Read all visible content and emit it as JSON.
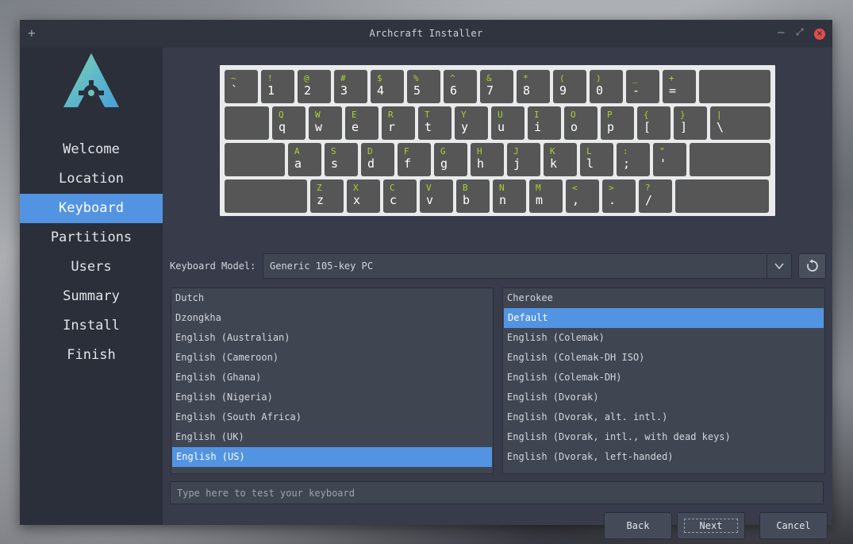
{
  "window": {
    "title": "Archcraft Installer",
    "pin_icon": "+",
    "minimize_icon": "–",
    "maximize_icon": "⤢",
    "close_icon": "×"
  },
  "sidebar": {
    "items": [
      {
        "label": "Welcome",
        "active": false
      },
      {
        "label": "Location",
        "active": false
      },
      {
        "label": "Keyboard",
        "active": true
      },
      {
        "label": "Partitions",
        "active": false
      },
      {
        "label": "Users",
        "active": false
      },
      {
        "label": "Summary",
        "active": false
      },
      {
        "label": "Install",
        "active": false
      },
      {
        "label": "Finish",
        "active": false
      }
    ]
  },
  "keyboard_preview": {
    "rows": [
      [
        [
          "~",
          "`"
        ],
        [
          "!",
          "1"
        ],
        [
          "@",
          "2"
        ],
        [
          "#",
          "3"
        ],
        [
          "$",
          "4"
        ],
        [
          "%",
          "5"
        ],
        [
          "^",
          "6"
        ],
        [
          "&",
          "7"
        ],
        [
          "*",
          "8"
        ],
        [
          "(",
          "9"
        ],
        [
          ")",
          "0"
        ],
        [
          "_",
          "-"
        ],
        [
          "+",
          "="
        ],
        [
          "",
          ""
        ]
      ],
      [
        [
          "",
          ""
        ],
        [
          "Q",
          "q"
        ],
        [
          "W",
          "w"
        ],
        [
          "E",
          "e"
        ],
        [
          "R",
          "r"
        ],
        [
          "T",
          "t"
        ],
        [
          "Y",
          "y"
        ],
        [
          "U",
          "u"
        ],
        [
          "I",
          "i"
        ],
        [
          "O",
          "o"
        ],
        [
          "P",
          "p"
        ],
        [
          "{",
          "["
        ],
        [
          "}",
          "]"
        ],
        [
          "|",
          "\\"
        ]
      ],
      [
        [
          "",
          ""
        ],
        [
          "A",
          "a"
        ],
        [
          "S",
          "s"
        ],
        [
          "D",
          "d"
        ],
        [
          "F",
          "f"
        ],
        [
          "G",
          "g"
        ],
        [
          "H",
          "h"
        ],
        [
          "J",
          "j"
        ],
        [
          "K",
          "k"
        ],
        [
          "L",
          "l"
        ],
        [
          ":",
          ";"
        ],
        [
          "\"",
          "'"
        ],
        [
          "",
          ""
        ]
      ],
      [
        [
          "",
          ""
        ],
        [
          "Z",
          "z"
        ],
        [
          "X",
          "x"
        ],
        [
          "C",
          "c"
        ],
        [
          "V",
          "v"
        ],
        [
          "B",
          "b"
        ],
        [
          "N",
          "n"
        ],
        [
          "M",
          "m"
        ],
        [
          "<",
          ","
        ],
        [
          ">",
          "."
        ],
        [
          "?",
          "/"
        ],
        [
          "",
          ""
        ]
      ]
    ]
  },
  "model": {
    "label": "Keyboard Model:",
    "value": "Generic 105-key PC",
    "dropdown_icon": "chevron-down-icon",
    "reset_icon": "reset-icon"
  },
  "layouts": {
    "items": [
      "Dutch",
      "Dzongkha",
      "English (Australian)",
      "English (Cameroon)",
      "English (Ghana)",
      "English (Nigeria)",
      "English (South Africa)",
      "English (UK)",
      "English (US)"
    ],
    "selected": "English (US)"
  },
  "variants": {
    "items": [
      "Cherokee",
      "Default",
      "English (Colemak)",
      "English (Colemak-DH ISO)",
      "English (Colemak-DH)",
      "English (Dvorak)",
      "English (Dvorak, alt. intl.)",
      "English (Dvorak, intl., with dead keys)",
      "English (Dvorak, left-handed)"
    ],
    "selected": "Default"
  },
  "test_input": {
    "placeholder": "Type here to test your keyboard",
    "value": ""
  },
  "buttons": {
    "back": "Back",
    "next": "Next",
    "cancel": "Cancel"
  },
  "colors": {
    "accent": "#5294e2",
    "key_shift_label": "#a6d42a",
    "close_button": "#e54b4b"
  }
}
